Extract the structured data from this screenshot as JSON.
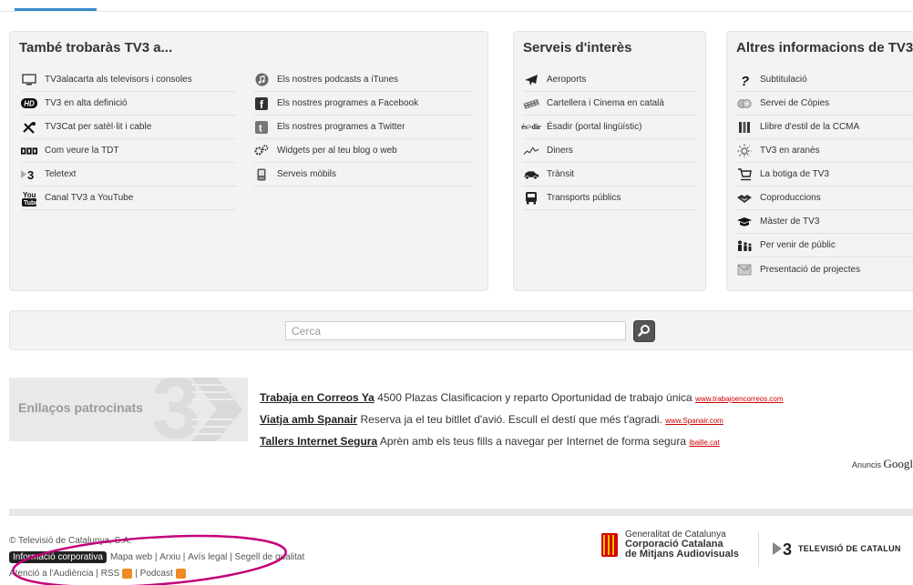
{
  "tambe": {
    "title": "També trobaràs TV3 a...",
    "left_items": [
      {
        "label": "TV3alacarta als televisors i consoles",
        "icon": "monitor-icon"
      },
      {
        "label": "TV3 en alta definició",
        "icon": "hd-icon"
      },
      {
        "label": "TV3Cat per satèl·lit i cable",
        "icon": "satellite-icon"
      },
      {
        "label": "Com veure la TDT",
        "icon": "tdt-icon"
      },
      {
        "label": "Teletext",
        "icon": "teletext-icon"
      },
      {
        "label": "Canal TV3 a YouTube",
        "icon": "youtube-icon"
      }
    ],
    "right_items": [
      {
        "label": "Els nostres podcasts a iTunes",
        "icon": "itunes-icon"
      },
      {
        "label": "Els nostres programes a Facebook",
        "icon": "facebook-icon"
      },
      {
        "label": "Els nostres programes a Twitter",
        "icon": "twitter-icon"
      },
      {
        "label": "Widgets per al teu blog o web",
        "icon": "widgets-icon"
      },
      {
        "label": "Serveis mòbils",
        "icon": "mobile-icon"
      }
    ]
  },
  "serveis": {
    "title": "Serveis d'interès",
    "items": [
      {
        "label": "Aeroports",
        "icon": "airplane-icon"
      },
      {
        "label": "Cartellera i Cinema en català",
        "icon": "film-icon"
      },
      {
        "label": "Ésadir (portal lingüístic)",
        "icon": "esadir-icon",
        "logo_text": "és>dir"
      },
      {
        "label": "Diners",
        "icon": "chart-icon"
      },
      {
        "label": "Trànsit",
        "icon": "car-icon"
      },
      {
        "label": "Transports públics",
        "icon": "bus-icon"
      }
    ]
  },
  "altres": {
    "title": "Altres informacions de TV3",
    "items": [
      {
        "label": "Subtitulació",
        "icon": "question-icon"
      },
      {
        "label": "Servei de Còpies",
        "icon": "discs-icon"
      },
      {
        "label": "Llibre d'estil de la CCMA",
        "icon": "books-icon"
      },
      {
        "label": "TV3 en aranès",
        "icon": "sun-icon"
      },
      {
        "label": "La botiga de TV3",
        "icon": "cart-icon"
      },
      {
        "label": "Coproduccions",
        "icon": "handshake-icon"
      },
      {
        "label": "Màster de TV3",
        "icon": "graduation-cap-icon"
      },
      {
        "label": "Per venir de públic",
        "icon": "people-icon"
      },
      {
        "label": "Presentació de projectes",
        "icon": "envelope-icon"
      }
    ]
  },
  "search": {
    "placeholder": "Cerca"
  },
  "sponsored": {
    "label": "Enllaços patrocinats",
    "ads": [
      {
        "title": "Trabaja en Correos Ya",
        "text": " 4500 Plazas Clasificacion y reparto Oportunidad de trabajo única ",
        "url": "www.trabajoencorreos.com"
      },
      {
        "title": "Viatja amb Spanair",
        "text": " Reserva ja el teu bitllet d'avió. Escull el destí que més t'agradi. ",
        "url": "www.Spanair.com"
      },
      {
        "title": "Tallers Internet Segura",
        "text": " Aprèn amb els teus fills a navegar per Internet de forma segura ",
        "url": "ibaille.cat"
      }
    ],
    "anuncis": "Anuncis",
    "google": "Googl"
  },
  "footer": {
    "copyright": "© Televisió de Catalunya, S.A.",
    "info_corporativa": "Informació corporativa",
    "links1": [
      "Mapa web",
      "Arxiu",
      "Avís legal",
      "Segell de qualitat"
    ],
    "links2": [
      "Atenció a l'Audiència",
      "RSS",
      "Podcast"
    ],
    "gencat": {
      "line1": "Generalitat de Catalunya",
      "line2": "Corporació Catalana",
      "line3": "de Mitjans Audiovisuals"
    },
    "tvc_name": "TELEVISIÓ DE CATALUN"
  },
  "colors": {
    "accent": "#3a8bc9",
    "annotation": "#c4007a",
    "rss": "#f08a24",
    "gencat": "#d40000"
  }
}
